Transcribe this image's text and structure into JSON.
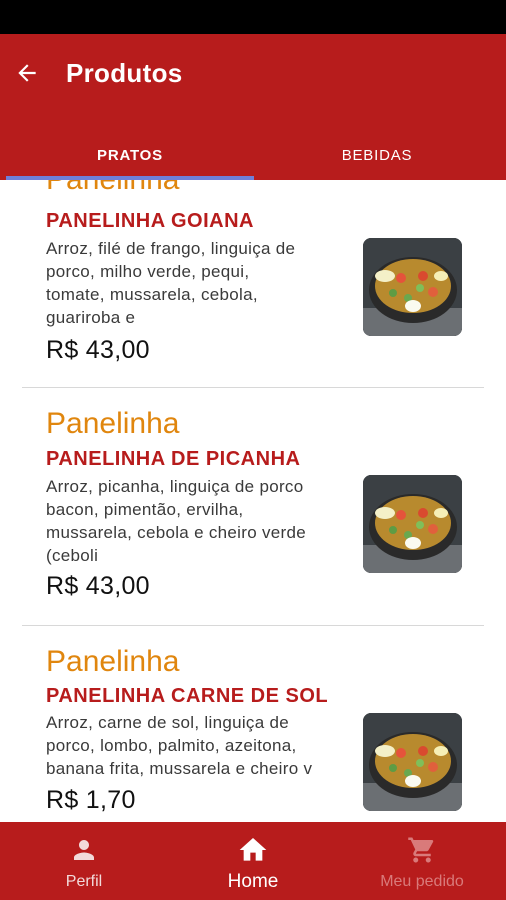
{
  "header": {
    "title": "Produtos",
    "back_icon": "arrow-left-icon"
  },
  "tabs": [
    {
      "label": "PRATOS",
      "active": true
    },
    {
      "label": "BEBIDAS",
      "active": false
    }
  ],
  "products": [
    {
      "category": "Panelinha",
      "name": "PANELINHA GOIANA",
      "description_lines": [
        "Arroz, filé de frango, linguiça de",
        "porco, milho verde, pequi,",
        "tomate, mussarela, cebola,",
        "guariroba e"
      ],
      "price": "R$ 43,00"
    },
    {
      "category": "Panelinha",
      "name": "PANELINHA DE PICANHA",
      "description_lines": [
        "Arroz, picanha, linguiça de porco",
        "bacon, pimentão, ervilha,",
        "mussarela, cebola e cheiro verde",
        "(ceboli"
      ],
      "price": "R$ 43,00"
    },
    {
      "category": "Panelinha",
      "name": "PANELINHA CARNE DE SOL",
      "description_lines": [
        "Arroz, carne de sol, linguiça de",
        "porco, lombo, palmito, azeitona,",
        "banana frita, mussarela e cheiro v"
      ],
      "price": "R$ 1,70"
    }
  ],
  "bottom_nav": [
    {
      "label": "Perfil",
      "icon": "person-icon",
      "active": false
    },
    {
      "label": "Home",
      "icon": "home-icon",
      "active": true
    },
    {
      "label": "Meu pedido",
      "icon": "cart-icon",
      "active": false,
      "disabled": true
    }
  ],
  "colors": {
    "primary": "#b71c1c",
    "category": "#e0860e",
    "tab_indicator": "#6f7fd8",
    "status_bar": "#000000"
  }
}
